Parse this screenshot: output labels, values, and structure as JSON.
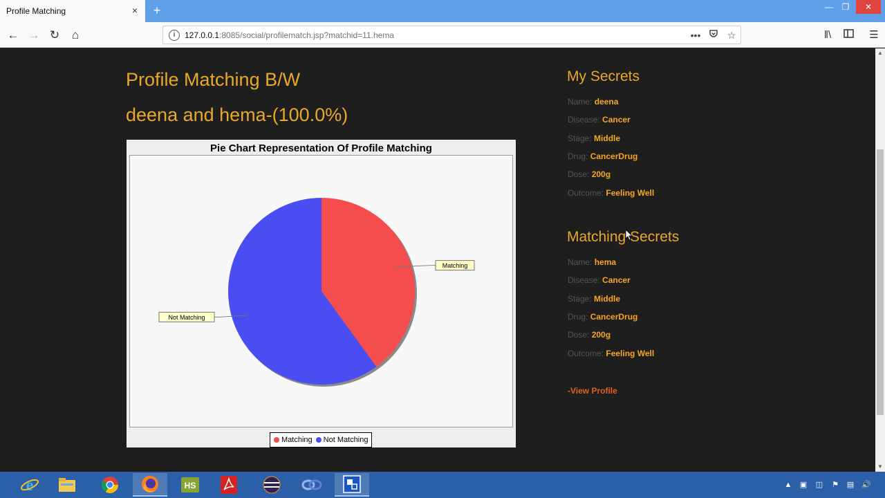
{
  "browser": {
    "tab_title": "Profile Matching",
    "tab_close": "×",
    "new_tab": "+",
    "url_host": "127.0.0.1",
    "url_rest": ":8085/social/profilematch.jsp?matchid=11.hema"
  },
  "page": {
    "heading_line1": "Profile Matching B/W",
    "heading_line2": "deena and hema-(100.0%)"
  },
  "chart_data": {
    "type": "pie",
    "title": "Pie Chart Representation Of Profile Matching",
    "series": [
      {
        "name": "Matching",
        "value": 40,
        "color": "#f54d4d"
      },
      {
        "name": "Not Matching",
        "value": 60,
        "color": "#4a4df2"
      }
    ],
    "legend_placement": "bottom"
  },
  "my_secrets": {
    "heading": "My Secrets",
    "fields": [
      {
        "label": "Name:",
        "value": "deena"
      },
      {
        "label": "Disease:",
        "value": "Cancer"
      },
      {
        "label": "Stage:",
        "value": "Middle"
      },
      {
        "label": "Drug:",
        "value": "CancerDrug"
      },
      {
        "label": "Dose:",
        "value": "200g"
      },
      {
        "label": "Outcome:",
        "value": "Feeling Well"
      }
    ]
  },
  "matching_secrets": {
    "heading": "Matching Secrets",
    "fields": [
      {
        "label": "Name:",
        "value": "hema"
      },
      {
        "label": "Disease:",
        "value": "Cancer"
      },
      {
        "label": "Stage:",
        "value": "Middle"
      },
      {
        "label": "Drug:",
        "value": "CancerDrug"
      },
      {
        "label": "Dose:",
        "value": "200g"
      },
      {
        "label": "Outcome:",
        "value": "Feeling Well"
      }
    ]
  },
  "view_profile_label": "-View Profile",
  "colors": {
    "accent": "#e8a92a",
    "value_text": "#f5a623",
    "link": "#e0631e",
    "background": "#1e1e1e"
  }
}
